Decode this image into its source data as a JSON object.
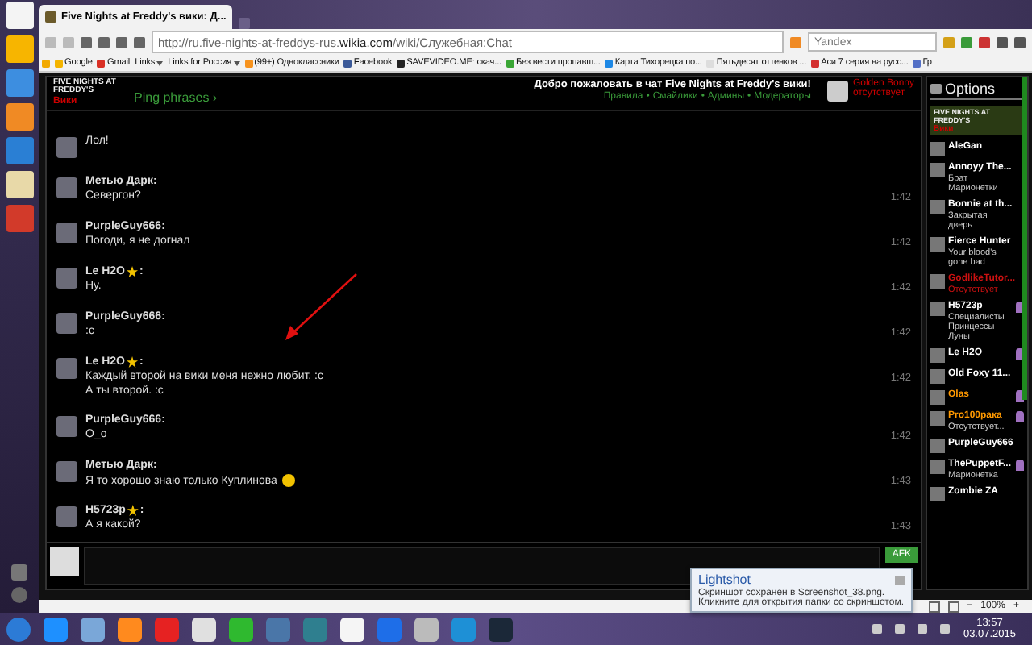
{
  "browser": {
    "tabs": [
      {
        "title": "Five Nights at Freddy's вики: Д...",
        "selected": true
      }
    ],
    "url": "http://ru.five-nights-at-freddys-rus.**wikia.com**/wiki/Служебная:Chat",
    "search": {
      "placeholder": "Yandex"
    },
    "bookmarks": [
      {
        "label": "Google",
        "kind": "link",
        "color": "#f4b400"
      },
      {
        "label": "Gmail",
        "kind": "link",
        "color": "#d93025"
      },
      {
        "label": "Links",
        "kind": "folder"
      },
      {
        "label": "Links for Россия",
        "kind": "folder"
      },
      {
        "label": "(99+) Одноклассники",
        "kind": "link",
        "color": "#f7931e"
      },
      {
        "label": "Facebook",
        "kind": "link",
        "color": "#3b5998"
      },
      {
        "label": "SAVEVIDEO.ME: скач...",
        "kind": "link",
        "color": "#222222"
      },
      {
        "label": "Без вести пропавш...",
        "kind": "link",
        "color": "#3aa635"
      },
      {
        "label": "Карта Тихорецка по...",
        "kind": "link",
        "color": "#1e88e5"
      },
      {
        "label": "Пятьдесят оттенков ...",
        "kind": "link",
        "color": "#dddddd"
      },
      {
        "label": "Аси 7 серия на русс...",
        "kind": "link",
        "color": "#d32f2f"
      },
      {
        "label": "Гр",
        "kind": "link",
        "color": "#5470c6"
      }
    ]
  },
  "chat": {
    "logo": "FIVE NIGHTS AT FREDDY'S",
    "logo_sub": "Вики",
    "ping": "Ping phrases ›",
    "welcome": "Добро пожаловать в чат Five Nights at Freddy's вики!",
    "links": [
      "Правила",
      "Смайлики",
      "Админы",
      "Модераторы"
    ],
    "link_separator": "•",
    "me": {
      "name": "Golden Bonny",
      "status": "отсутствует"
    },
    "messages": [
      {
        "kind": "continued",
        "lines": [
          "Лол!"
        ]
      },
      {
        "kind": "full",
        "name": "Метью Дарк:",
        "lines": [
          "Севергон?"
        ],
        "time": "1:42",
        "moderator": false,
        "emoji": false
      },
      {
        "kind": "full",
        "name": "PurpleGuy666:",
        "lines": [
          "Погоди, я не догнал"
        ],
        "time": "1:42",
        "moderator": false,
        "emoji": false
      },
      {
        "kind": "full",
        "name": "Le H2O",
        "name_end": ":",
        "lines": [
          "Ну."
        ],
        "time": "1:42",
        "moderator": true,
        "emoji": false
      },
      {
        "kind": "full",
        "name": "PurpleGuy666:",
        "lines": [
          ":c"
        ],
        "time": "1:42",
        "moderator": false,
        "emoji": false
      },
      {
        "kind": "full",
        "name": "Le H2O",
        "name_end": ":",
        "lines": [
          "Каждый второй на вики меня нежно любит. :c",
          "А ты второй. :c"
        ],
        "time": "1:42",
        "moderator": true,
        "emoji": false
      },
      {
        "kind": "full",
        "name": "PurpleGuy666:",
        "lines": [
          "O_o"
        ],
        "time": "1:42",
        "moderator": false,
        "emoji": false
      },
      {
        "kind": "full",
        "name": "Метью Дарк:",
        "lines": [
          "Я то хорошо знаю только Куплинова"
        ],
        "time": "1:43",
        "moderator": false,
        "emoji": true
      },
      {
        "kind": "full",
        "name": "H5723p",
        "name_end": ":",
        "lines": [
          "А я какой?"
        ],
        "time": "1:43",
        "moderator": true,
        "emoji": false
      }
    ],
    "afk_button": "AFK"
  },
  "user_list": {
    "title": "Options",
    "wiki": {
      "logo": "FIVE NIGHTS AT FREDDY'S",
      "label": "Вики"
    },
    "users": [
      {
        "name": "AleGan",
        "color": "#ffffff",
        "chat_mod": false
      },
      {
        "name": "Annoyy The...",
        "status": "Брат Марионетки",
        "color": "#ffffff",
        "chat_mod": false
      },
      {
        "name": "Bonnie at th...",
        "status": "Закрытая дверь",
        "color": "#ffffff",
        "chat_mod": false
      },
      {
        "name": "Fierce Hunter",
        "status": "Your blood's gone bad",
        "color": "#ffffff",
        "chat_mod": false
      },
      {
        "name": "GodlikeTutor...",
        "status": "Отсутствует",
        "color": "#cc1111",
        "chat_mod": false
      },
      {
        "name": "H5723p",
        "status": "Специалисты Принцессы Луны",
        "color": "#ffffff",
        "chat_mod": true
      },
      {
        "name": "Le H2O",
        "color": "#ffffff",
        "chat_mod": true
      },
      {
        "name": "Old Foxy 11...",
        "color": "#ffffff",
        "chat_mod": false
      },
      {
        "name": "Olas",
        "color": "#ff9900",
        "chat_mod": true
      },
      {
        "name": "Pro100рака",
        "status": "Отсутствует...",
        "color": "#ff9900",
        "chat_mod": true
      },
      {
        "name": "PurpleGuy666",
        "color": "#ffffff",
        "chat_mod": false
      },
      {
        "name": "ThePuppetF...",
        "status": "Марионетка",
        "color": "#ffffff",
        "chat_mod": true
      },
      {
        "name": "Zombie ZA",
        "color": "#ffffff",
        "chat_mod": false
      }
    ]
  },
  "status_bar": {
    "zoom_out": "−",
    "zoom": "100%",
    "zoom_in": "+"
  },
  "toast": {
    "title": "Lightshot",
    "text": "Скриншот сохранен в Screenshot_38.png. Кликните для открытия папки со скриншотом."
  },
  "clock": {
    "time": "13:57",
    "date": "03.07.2015"
  }
}
